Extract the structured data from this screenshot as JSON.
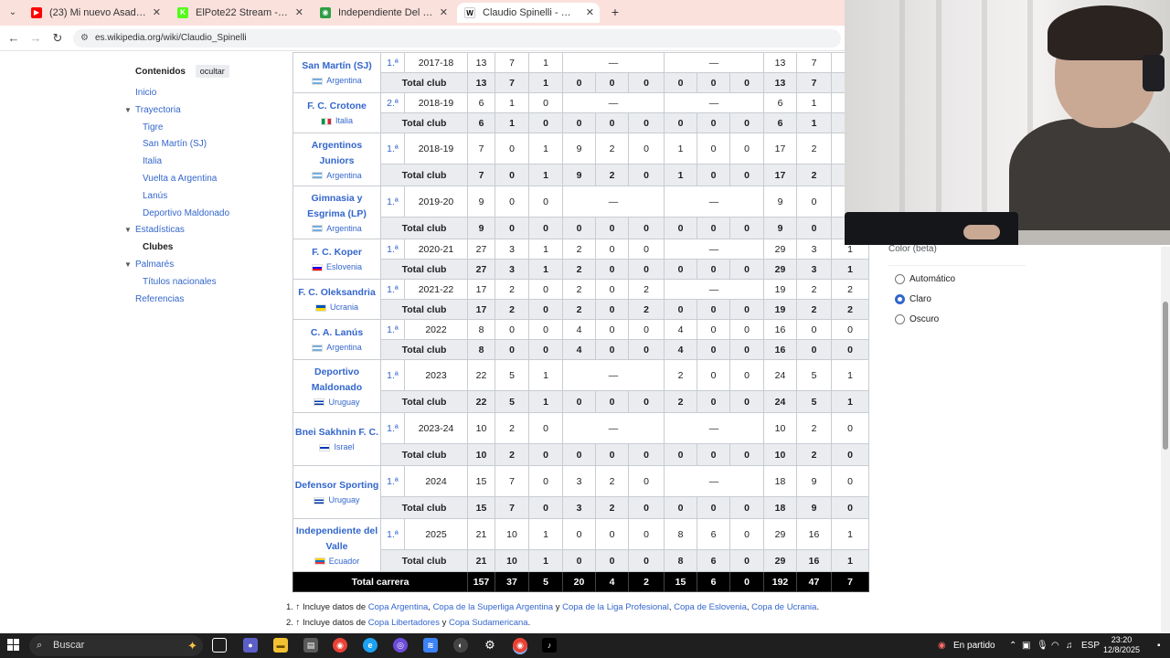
{
  "browser": {
    "tabs": [
      {
        "label": "(23) Mi nuevo Asador con Brisk",
        "icon": "youtube-icon",
        "color": "#ff0000",
        "active": false
      },
      {
        "label": "ElPote22 Stream - Watch Live o",
        "icon": "kick-icon",
        "color": "#53fc18",
        "active": false
      },
      {
        "label": "Independiente Del Valle Vs Mu",
        "icon": "globe-icon",
        "color": "#2e9e44",
        "active": false
      },
      {
        "label": "Claudio Spinelli - Wikipedia, la",
        "icon": "wikipedia-icon",
        "color": "#ffffff",
        "active": true
      }
    ],
    "url": "es.wikipedia.org/wiki/Claudio_Spinelli"
  },
  "toc": {
    "title": "Contenidos",
    "hide_label": "ocultar",
    "items": [
      {
        "label": "Inicio",
        "level": 1,
        "caret": false,
        "current": false
      },
      {
        "label": "Trayectoria",
        "level": 1,
        "caret": true,
        "current": false
      },
      {
        "label": "Tigre",
        "level": 2,
        "caret": false,
        "current": false
      },
      {
        "label": "San Martín (SJ)",
        "level": 2,
        "caret": false,
        "current": false
      },
      {
        "label": "Italia",
        "level": 2,
        "caret": false,
        "current": false
      },
      {
        "label": "Vuelta a Argentina",
        "level": 2,
        "caret": false,
        "current": false
      },
      {
        "label": "Lanús",
        "level": 2,
        "caret": false,
        "current": false
      },
      {
        "label": "Deportivo Maldonado",
        "level": 2,
        "caret": false,
        "current": false
      },
      {
        "label": "Estadísticas",
        "level": 1,
        "caret": true,
        "current": false
      },
      {
        "label": "Clubes",
        "level": 2,
        "caret": false,
        "current": true
      },
      {
        "label": "Palmarés",
        "level": 1,
        "caret": true,
        "current": false
      },
      {
        "label": "Títulos nacionales",
        "level": 2,
        "caret": false,
        "current": false
      },
      {
        "label": "Referencias",
        "level": 1,
        "caret": false,
        "current": false
      }
    ]
  },
  "flags": {
    "Argentina": [
      "#74acdf",
      "#ffffff",
      "#74acdf"
    ],
    "Italia": [
      "#009246",
      "#ffffff",
      "#ce2b37"
    ],
    "Eslovenia": [
      "#ffffff",
      "#0000ff",
      "#ff0000"
    ],
    "Ucrania": [
      "#0057b7",
      "#ffd700"
    ],
    "Uruguay": [
      "#ffffff",
      "#0038a8",
      "#ffffff",
      "#0038a8"
    ],
    "Israel": [
      "#ffffff",
      "#0038b8",
      "#ffffff"
    ],
    "Ecuador": [
      "#ffd100",
      "#0072ce",
      "#ef3340"
    ]
  },
  "clubs": [
    {
      "name": "San Martín (SJ)",
      "country": "Argentina",
      "div": "1.ª",
      "season": "2017-18",
      "row": [
        "13",
        "7",
        "1",
        "—",
        "",
        "—",
        "",
        "13",
        "7",
        ""
      ],
      "total": [
        "13",
        "7",
        "1",
        "0",
        "0",
        "0",
        "0",
        "0",
        "0",
        "13",
        "7",
        ""
      ]
    },
    {
      "name": "F. C. Crotone",
      "country": "Italia",
      "div": "2.ª",
      "season": "2018-19",
      "row": [
        "6",
        "1",
        "0",
        "—",
        "",
        "—",
        "",
        "6",
        "1",
        ""
      ],
      "total": [
        "6",
        "1",
        "0",
        "0",
        "0",
        "0",
        "0",
        "0",
        "0",
        "6",
        "1",
        ""
      ]
    },
    {
      "name": "Argentinos Juniors",
      "country": "Argentina",
      "div": "1.ª",
      "season": "2018-19",
      "row6": [
        "7",
        "0",
        "1",
        "9",
        "2",
        "0",
        "1",
        "0",
        "0",
        "17",
        "2",
        ""
      ],
      "total": [
        "7",
        "0",
        "1",
        "9",
        "2",
        "0",
        "1",
        "0",
        "0",
        "17",
        "2",
        ""
      ]
    },
    {
      "name": "Gimnasia y Esgrima (LP)",
      "country": "Argentina",
      "div": "1.ª",
      "season": "2019-20",
      "row": [
        "9",
        "0",
        "0",
        "—",
        "",
        "—",
        "",
        "9",
        "0",
        ""
      ],
      "total": [
        "9",
        "0",
        "0",
        "0",
        "0",
        "0",
        "0",
        "0",
        "0",
        "9",
        "0",
        ""
      ]
    },
    {
      "name": "F. C. Koper",
      "country": "Eslovenia",
      "div": "1.ª",
      "season": "2020-21",
      "row7": [
        "27",
        "3",
        "1",
        "2",
        "0",
        "0",
        "—",
        "29",
        "3",
        "1"
      ],
      "total": [
        "27",
        "3",
        "1",
        "2",
        "0",
        "0",
        "0",
        "0",
        "0",
        "29",
        "3",
        "1"
      ]
    },
    {
      "name": "F. C. Oleksandria",
      "country": "Ucrania",
      "div": "1.ª",
      "season": "2021-22",
      "row7": [
        "17",
        "2",
        "0",
        "2",
        "0",
        "2",
        "—",
        "19",
        "2",
        "2"
      ],
      "total": [
        "17",
        "2",
        "0",
        "2",
        "0",
        "2",
        "0",
        "0",
        "0",
        "19",
        "2",
        "2"
      ]
    },
    {
      "name": "C. A. Lanús",
      "country": "Argentina",
      "div": "1.ª",
      "season": "2022",
      "row6": [
        "8",
        "0",
        "0",
        "4",
        "0",
        "0",
        "4",
        "0",
        "0",
        "16",
        "0",
        "0"
      ],
      "total": [
        "8",
        "0",
        "0",
        "4",
        "0",
        "0",
        "4",
        "0",
        "0",
        "16",
        "0",
        "0"
      ]
    },
    {
      "name": "Deportivo Maldonado",
      "country": "Uruguay",
      "div": "1.ª",
      "season": "2023",
      "row8": [
        "22",
        "5",
        "1",
        "—",
        "2",
        "0",
        "0",
        "24",
        "5",
        "1"
      ],
      "total": [
        "22",
        "5",
        "1",
        "0",
        "0",
        "0",
        "2",
        "0",
        "0",
        "24",
        "5",
        "1"
      ]
    },
    {
      "name": "Bnei Sakhnin F. C.",
      "country": "Israel",
      "div": "1.ª",
      "season": "2023-24",
      "row": [
        "10",
        "2",
        "0",
        "—",
        "",
        "—",
        "",
        "10",
        "2",
        "0"
      ],
      "total": [
        "10",
        "2",
        "0",
        "0",
        "0",
        "0",
        "0",
        "0",
        "0",
        "10",
        "2",
        "0"
      ]
    },
    {
      "name": "Defensor Sporting",
      "country": "Uruguay",
      "div": "1.ª",
      "season": "2024",
      "row7": [
        "15",
        "7",
        "0",
        "3",
        "2",
        "0",
        "—",
        "18",
        "9",
        "0"
      ],
      "total": [
        "15",
        "7",
        "0",
        "3",
        "2",
        "0",
        "0",
        "0",
        "0",
        "18",
        "9",
        "0"
      ]
    },
    {
      "name": "Independiente del Valle",
      "country": "Ecuador",
      "div": "1.ª",
      "season": "2025",
      "row6": [
        "21",
        "10",
        "1",
        "0",
        "0",
        "0",
        "8",
        "6",
        "0",
        "29",
        "16",
        "1"
      ],
      "total": [
        "21",
        "10",
        "1",
        "0",
        "0",
        "0",
        "8",
        "6",
        "0",
        "29",
        "16",
        "1"
      ]
    }
  ],
  "total_club_label": "Total club",
  "grand_total": {
    "label": "Total carrera",
    "values": [
      "157",
      "37",
      "5",
      "20",
      "4",
      "2",
      "15",
      "6",
      "0",
      "192",
      "47",
      "7"
    ]
  },
  "notes": [
    {
      "prefix": "1. ↑ Incluye datos de ",
      "links": [
        "Copa Argentina",
        "Copa de la Superliga Argentina",
        "Copa de la Liga Profesional",
        "Copa de Eslovenia",
        "Copa de Ucrania"
      ],
      "joiners": [
        ", ",
        " y ",
        ", ",
        ", "
      ],
      "suffix": "."
    },
    {
      "prefix": "2. ↑ Incluye datos de ",
      "links": [
        "Copa Libertadores",
        "Copa Sudamericana"
      ],
      "joiners": [
        " y "
      ],
      "suffix": "."
    }
  ],
  "settings": {
    "title": "Color (beta)",
    "options": [
      {
        "label": "Automático",
        "checked": false
      },
      {
        "label": "Claro",
        "checked": true
      },
      {
        "label": "Oscuro",
        "checked": false
      }
    ]
  },
  "taskbar": {
    "search_placeholder": "Buscar",
    "status_text": "En partido",
    "language": "ESP",
    "time": "23:20",
    "date": "12/8/2025",
    "accent": "#3366cc"
  }
}
